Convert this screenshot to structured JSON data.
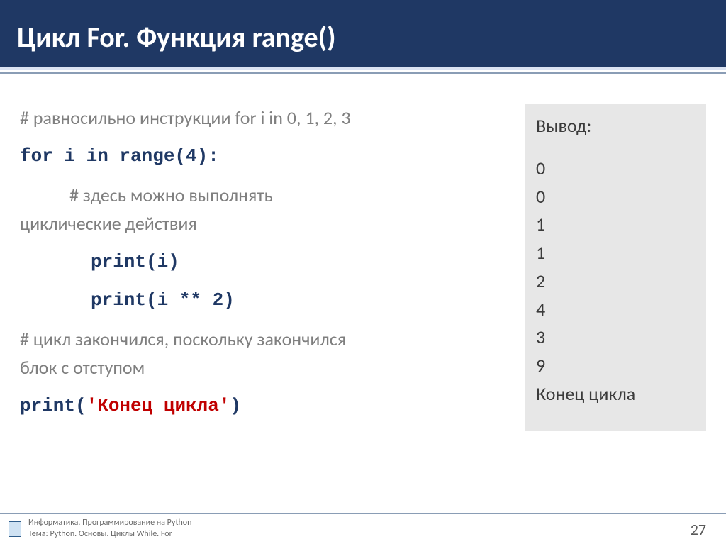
{
  "header": {
    "title": "Цикл For. Функция range()"
  },
  "code": {
    "comment1": "# равносильно инструкции for i in 0, 1, 2, 3",
    "for_line": "for i in range(4):",
    "comment2a": "# здесь можно выполнять",
    "comment2b": "циклические действия",
    "print1": "print(i)",
    "print2": "print(i ** 2)",
    "comment3a": "# цикл закончился, поскольку закончился",
    "comment3b": "блок с отступом",
    "print3_a": "print(",
    "print3_str": "'Конец цикла'",
    "print3_b": ")"
  },
  "output": {
    "label": "Вывод:",
    "lines": [
      "0",
      "0",
      "1",
      "1",
      "2",
      "4",
      "3",
      "9",
      "Конец цикла"
    ]
  },
  "footer": {
    "line1": "Информатика. Программирование на Python",
    "line2": "Тема: Python. Основы. Циклы While. For",
    "page": "27"
  }
}
